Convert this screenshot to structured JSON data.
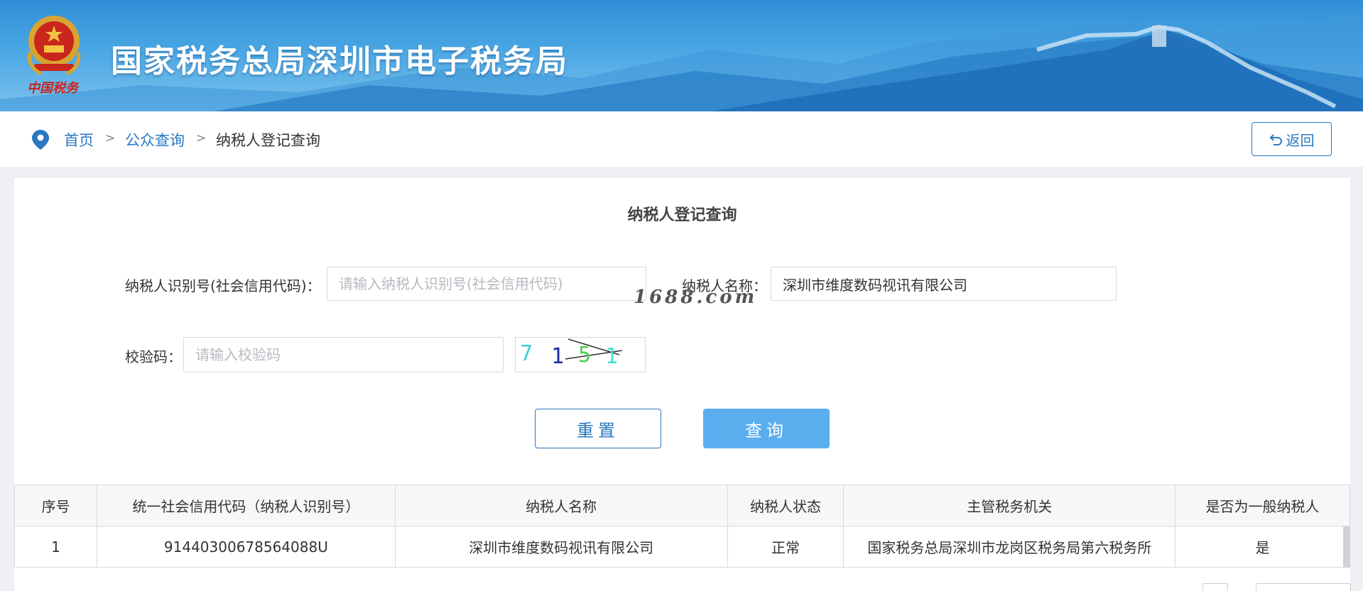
{
  "header": {
    "title": "国家税务总局深圳市电子税务局",
    "emblem_caption": "中国税务"
  },
  "breadcrumb": {
    "home": "首页",
    "separator": ">",
    "public_query": "公众查询",
    "current": "纳税人登记查询",
    "back_label": "返回",
    "back_icon": "undo-arrow-icon"
  },
  "form": {
    "title": "纳税人登记查询",
    "taxpayer_id_label": "纳税人识别号(社会信用代码)：",
    "taxpayer_id_placeholder": "请输入纳税人识别号(社会信用代码)",
    "taxpayer_id_value": "",
    "taxpayer_name_label": "纳税人名称：",
    "taxpayer_name_value": "深圳市维度数码视讯有限公司",
    "captcha_label": "校验码：",
    "captcha_placeholder": "请输入校验码",
    "captcha_chars": [
      "7",
      "1",
      "5",
      "1"
    ],
    "reset_label": "重置",
    "query_label": "查询"
  },
  "watermark": "1688.com",
  "table": {
    "headers": [
      "序号",
      "统一社会信用代码（纳税人识别号）",
      "纳税人名称",
      "纳税人状态",
      "主管税务机关",
      "是否为一般纳税人"
    ],
    "rows": [
      [
        "1",
        "91440300678564088U",
        "深圳市维度数码视讯有限公司",
        "正常",
        "国家税务总局深圳市龙岗区税务局第六税务所",
        "是"
      ]
    ]
  },
  "colors": {
    "accent": "#2a78c2",
    "query_button": "#5aaeee",
    "banner": "#2f8fd6"
  }
}
